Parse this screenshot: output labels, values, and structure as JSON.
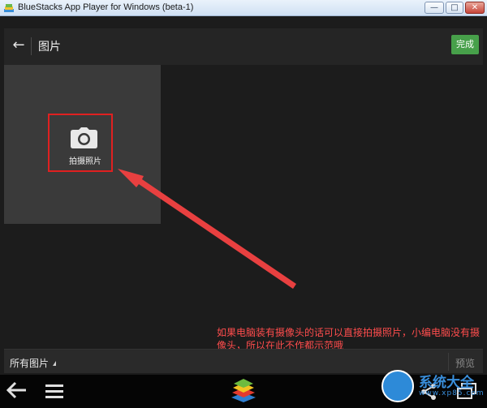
{
  "window": {
    "title": "BlueStacks App Player for Windows (beta-1)",
    "minimize_glyph": "—",
    "maximize_glyph": "□",
    "close_glyph": "✕"
  },
  "actionbar": {
    "back_glyph": "←",
    "title": "图片",
    "done_label": "完成"
  },
  "camera_tile": {
    "label": "拍摄照片",
    "icon": "camera-icon"
  },
  "annotation": {
    "note": "如果电脑装有摄像头的话可以直接拍摄照片，小编电脑没有摄像头，所以在此不作都示范哦",
    "highlight_color": "#e02020"
  },
  "bottom_bar": {
    "album_label": "所有图片",
    "preview_label": "预览"
  },
  "navbar": {
    "icons": [
      "back-arrow-icon",
      "menu-icon",
      "bluestacks-logo-icon",
      "share-icon",
      "window-icon"
    ]
  },
  "watermark": {
    "title": "系统大全",
    "url": "www.xp85.com"
  },
  "colors": {
    "accent_green": "#47a04a",
    "background": "#1c1c1c",
    "tile": "#3a3a3a",
    "annotation_red": "#ff4d4d"
  }
}
